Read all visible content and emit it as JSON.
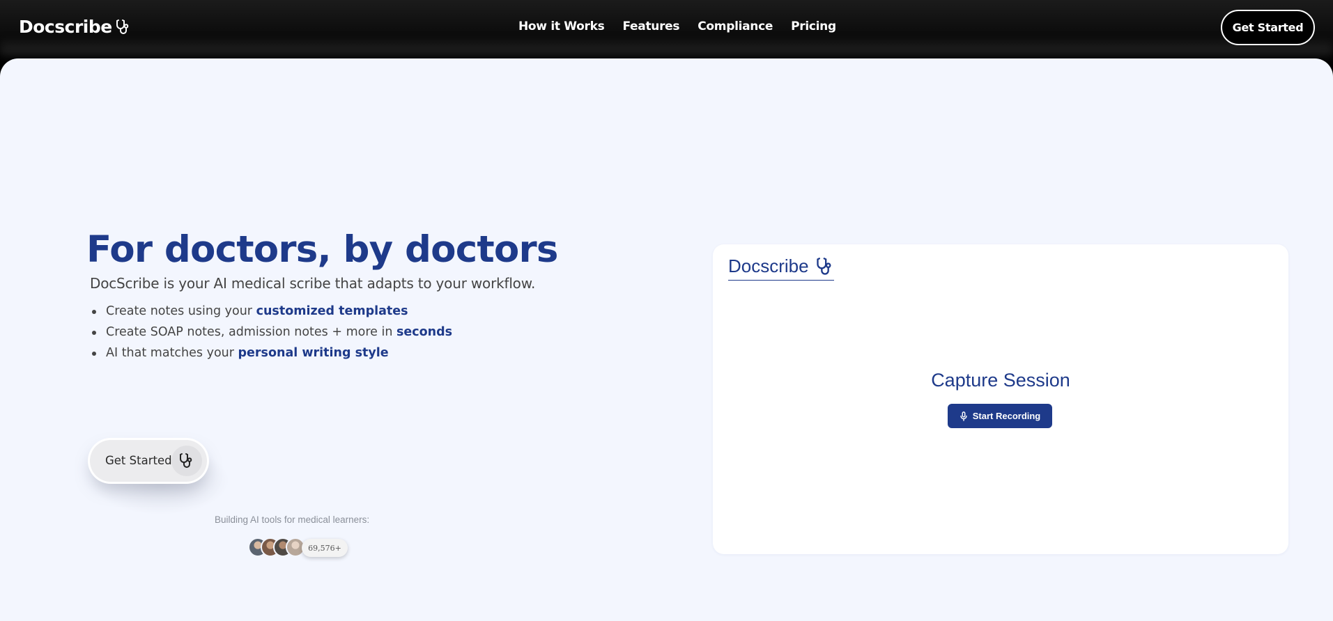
{
  "nav": {
    "brand": "Docscribe",
    "links": [
      "How it Works",
      "Features",
      "Compliance",
      "Pricing"
    ],
    "cta": "Get Started"
  },
  "hero": {
    "title": "For doctors, by doctors",
    "subtitle": "DocScribe is your AI medical scribe that adapts to your workflow.",
    "bullets": [
      {
        "text": "Create notes using your ",
        "highlight": "customized templates"
      },
      {
        "text": "Create SOAP notes, admission notes + more in ",
        "highlight": "seconds"
      },
      {
        "text": "AI that matches your ",
        "highlight": "personal writing style"
      }
    ],
    "cta": "Get Started"
  },
  "social_proof": {
    "caption": "Building AI tools for medical learners:",
    "count": "69,576+",
    "avatar_colors": [
      "#5b6470",
      "#7a5a48",
      "#4f4a45",
      "#b7a79a"
    ]
  },
  "app_card": {
    "brand": "Docscribe",
    "title": "Capture Session",
    "record_button": "Start Recording"
  },
  "colors": {
    "brand": "#1e3a8a",
    "background": "#f3f6fe",
    "nav_bg": "#000000"
  },
  "icons": {
    "brand_icon": "stethoscope-icon",
    "record_icon": "microphone-icon"
  }
}
